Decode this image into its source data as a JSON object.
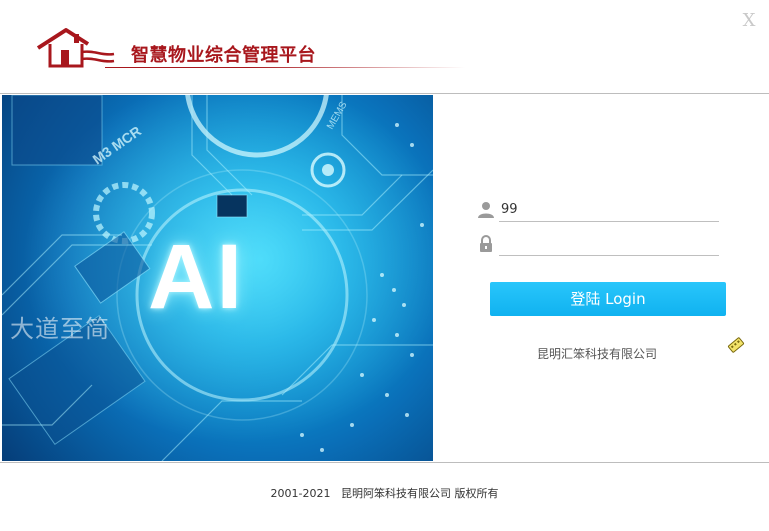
{
  "header": {
    "title": "智慧物业综合管理平台",
    "logo_icon": "house-logo-icon",
    "close_label": "X",
    "brand_color": "#a8171d"
  },
  "banner": {
    "headline": "AI",
    "slogan": "大道至简",
    "circuit_labels": [
      "M3 MCR",
      "MEMS"
    ]
  },
  "login": {
    "username_value": "99",
    "username_icon": "user-icon",
    "password_value": "",
    "password_icon": "lock-icon",
    "button_label": "登陆 Login",
    "button_color": "#1ab8f3",
    "company": "昆明汇笨科技有限公司",
    "ime_icon": "ime-keyboard-icon"
  },
  "footer": {
    "years": "2001-2021",
    "company": "昆明阿笨科技有限公司",
    "rights": "版权所有"
  }
}
